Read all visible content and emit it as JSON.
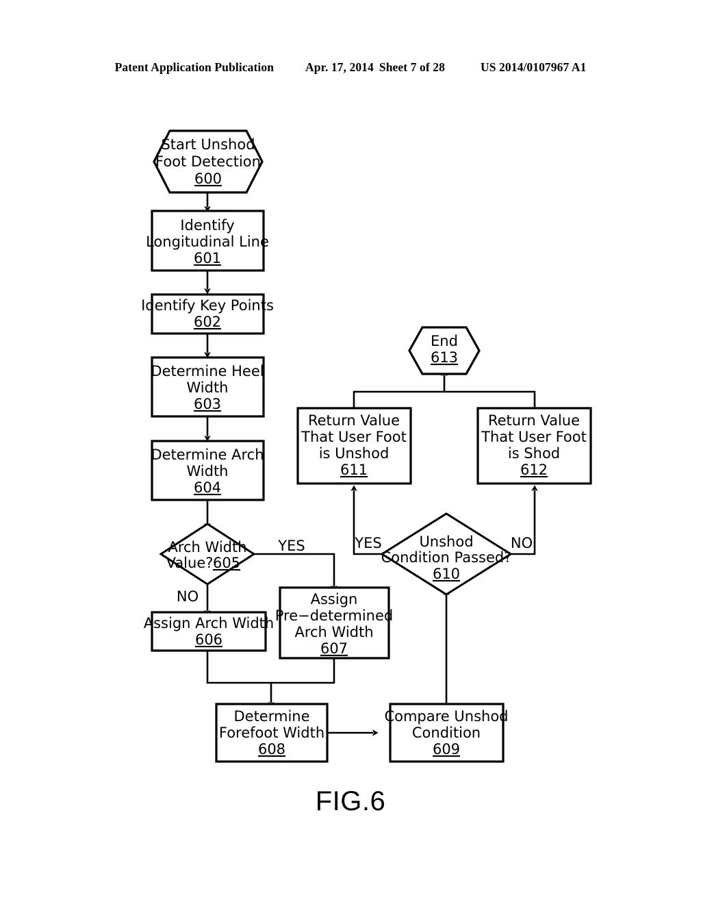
{
  "header": {
    "publication": "Patent Application Publication",
    "date": "Apr. 17, 2014",
    "sheet": "Sheet 7 of 28",
    "patent_number": "US 2014/0107967 A1"
  },
  "figure": {
    "caption": "FIG.6"
  },
  "flowchart": {
    "nodes": {
      "n600": {
        "shape": "hexagon",
        "lines": [
          "Start  Unshod",
          "Foot  Detection"
        ],
        "ref": "600"
      },
      "n601": {
        "shape": "rect",
        "lines": [
          "Identify",
          "Longitudinal  Line"
        ],
        "ref": "601"
      },
      "n602": {
        "shape": "rect",
        "lines": [
          "Identify  Key  Points"
        ],
        "ref": "602"
      },
      "n603": {
        "shape": "rect",
        "lines": [
          "Determine  Heel",
          "Width"
        ],
        "ref": "603"
      },
      "n604": {
        "shape": "rect",
        "lines": [
          "Determine  Arch",
          "Width"
        ],
        "ref": "604"
      },
      "n605": {
        "shape": "diamond",
        "lines": [
          "Arch  Width"
        ],
        "inline_ref_line": "Value?",
        "ref": "605"
      },
      "n606": {
        "shape": "rect",
        "lines": [
          "Assign  Arch  Width"
        ],
        "ref": "606"
      },
      "n607": {
        "shape": "rect",
        "lines": [
          "Assign",
          "Pre−determined",
          "Arch  Width"
        ],
        "ref": "607"
      },
      "n608": {
        "shape": "rect",
        "lines": [
          "Determine",
          "Forefoot  Width"
        ],
        "ref": "608"
      },
      "n609": {
        "shape": "rect",
        "lines": [
          "Compare  Unshod",
          "Condition"
        ],
        "ref": "609"
      },
      "n610": {
        "shape": "diamond",
        "lines": [
          "Unshod",
          "Condition  Passed?"
        ],
        "ref": "610"
      },
      "n611": {
        "shape": "rect",
        "lines": [
          "Return  Value",
          "That  User  Foot",
          "is  Unshod"
        ],
        "ref": "611"
      },
      "n612": {
        "shape": "rect",
        "lines": [
          "Return  Value",
          "That  User  Foot",
          "is  Shod"
        ],
        "ref": "612"
      },
      "n613": {
        "shape": "hexagon",
        "lines": [
          "End"
        ],
        "ref": "613"
      }
    },
    "edge_labels": {
      "yes_605": "YES",
      "no_605": "NO",
      "yes_610": "YES",
      "no_610": "NO"
    }
  }
}
